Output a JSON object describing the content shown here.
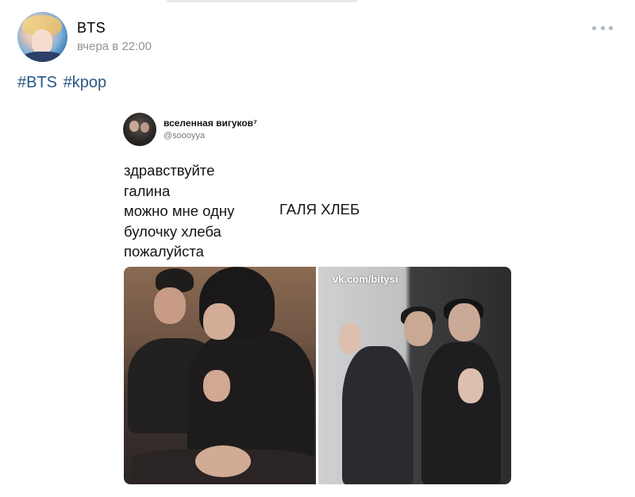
{
  "post": {
    "author_name": "BTS",
    "date": "вчера в 22:00",
    "hashtags": [
      "#BTS",
      "#kpop"
    ]
  },
  "icons": {
    "more": "more-horizontal-icon"
  },
  "tweet": {
    "display_name": "вселенная вигуков⁷",
    "handle": "@soooyya",
    "lines": [
      "здравствуйте",
      "галина",
      "можно мне одну",
      "булочку хлеба",
      "пожалуйста"
    ],
    "reply": "ГАЛЯ ХЛЕБ",
    "watermark": "vk.com/bitysi"
  }
}
